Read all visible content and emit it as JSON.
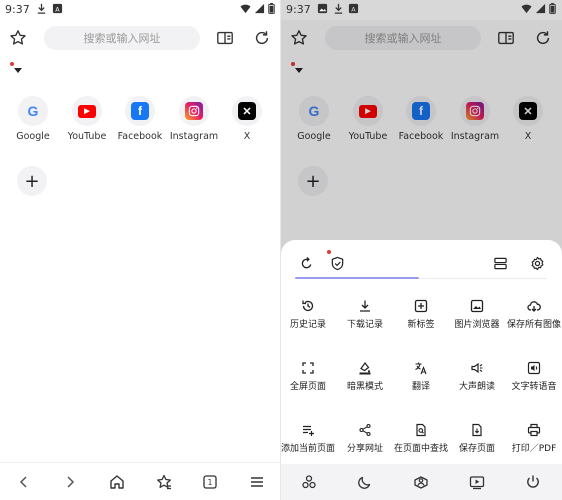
{
  "left": {
    "status": {
      "time": "9:37"
    },
    "url_placeholder": "搜索或输入网址",
    "shortcuts": [
      {
        "label": "Google",
        "icon": "google-icon"
      },
      {
        "label": "YouTube",
        "icon": "youtube-icon"
      },
      {
        "label": "Facebook",
        "icon": "facebook-icon"
      },
      {
        "label": "Instagram",
        "icon": "instagram-icon"
      },
      {
        "label": "X",
        "icon": "x-icon"
      }
    ],
    "add_label": "+",
    "tab_count": "1"
  },
  "right": {
    "status": {
      "time": "9:37"
    },
    "url_placeholder": "搜索或输入网址",
    "shortcuts": [
      {
        "label": "Google"
      },
      {
        "label": "YouTube"
      },
      {
        "label": "Facebook"
      },
      {
        "label": "Instagram"
      },
      {
        "label": "X"
      }
    ],
    "add_label": "+",
    "menu": [
      {
        "label": "历史记录",
        "icon": "history-icon"
      },
      {
        "label": "下载记录",
        "icon": "download-icon"
      },
      {
        "label": "新标签",
        "icon": "new-tab-icon"
      },
      {
        "label": "图片浏览器",
        "icon": "image-browser-icon"
      },
      {
        "label": "保存所有图像",
        "icon": "cloud-save-icon"
      },
      {
        "label": "全屏页面",
        "icon": "fullscreen-icon"
      },
      {
        "label": "暗黑模式",
        "icon": "dark-mode-icon"
      },
      {
        "label": "翻译",
        "icon": "translate-icon"
      },
      {
        "label": "大声朗读",
        "icon": "read-aloud-icon"
      },
      {
        "label": "文字转语音",
        "icon": "text-to-speech-icon"
      },
      {
        "label": "添加当前页面",
        "icon": "add-page-icon"
      },
      {
        "label": "分享网址",
        "icon": "share-icon"
      },
      {
        "label": "在页面中查找",
        "icon": "find-in-page-icon"
      },
      {
        "label": "保存页面",
        "icon": "save-page-icon"
      },
      {
        "label": "打印／PDF",
        "icon": "print-icon"
      }
    ]
  },
  "colors": {
    "accent": "#9b9bf0",
    "red_dot": "#e53935",
    "youtube": "#ff0000",
    "facebook": "#1877f2",
    "x": "#000000"
  }
}
